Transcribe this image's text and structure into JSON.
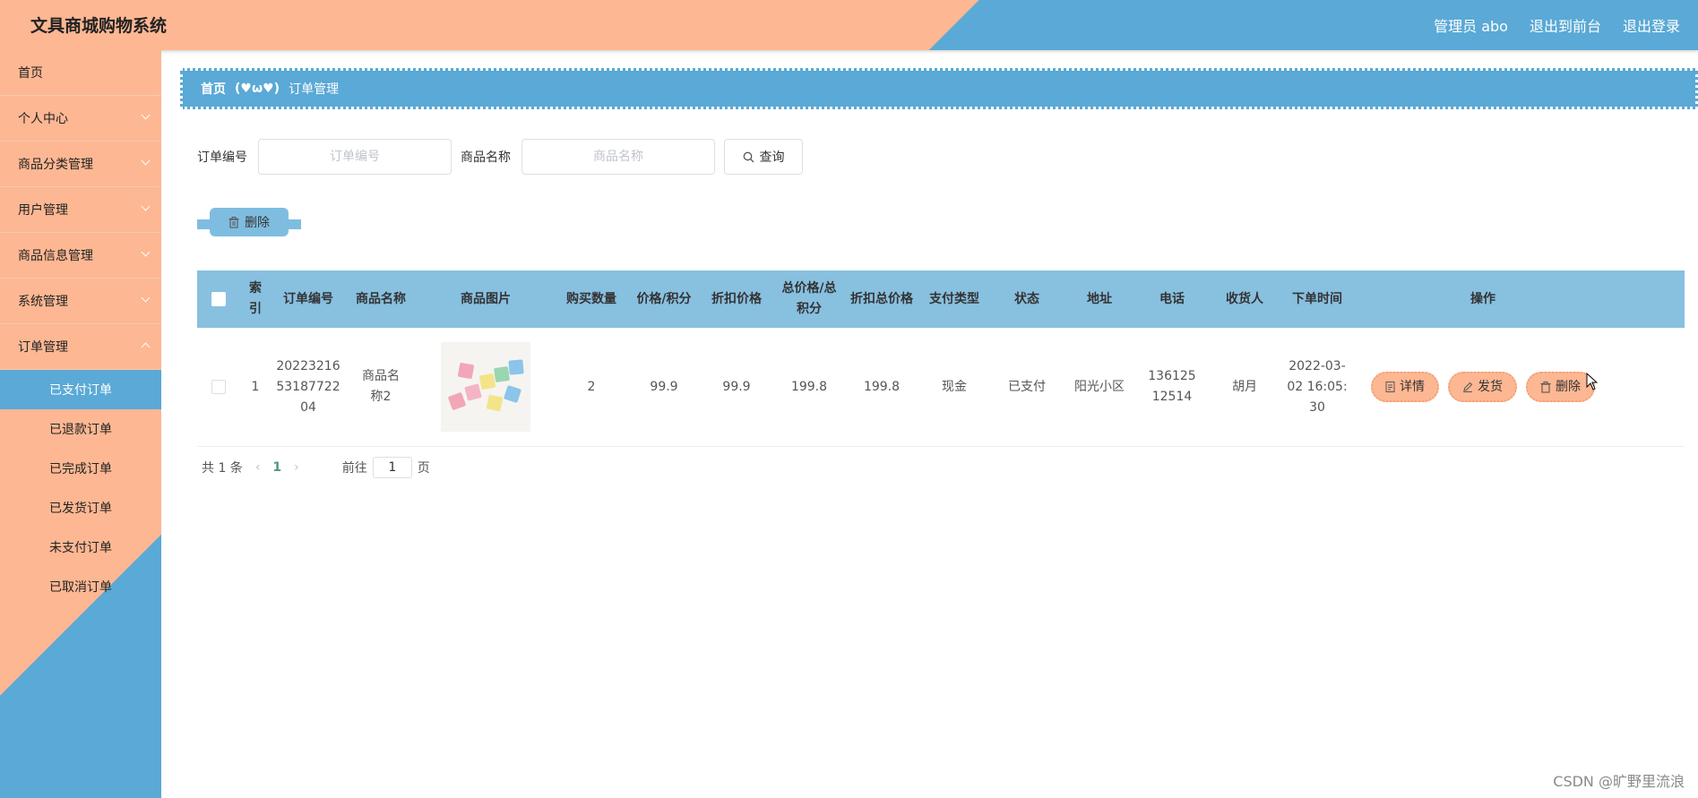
{
  "header": {
    "title": "文具商城购物系统",
    "admin_label": "管理员 abo",
    "back_label": "退出到前台",
    "logout_label": "退出登录"
  },
  "sidebar": {
    "items": [
      {
        "label": "首页"
      },
      {
        "label": "个人中心"
      },
      {
        "label": "商品分类管理"
      },
      {
        "label": "用户管理"
      },
      {
        "label": "商品信息管理"
      },
      {
        "label": "系统管理"
      },
      {
        "label": "订单管理"
      }
    ],
    "subitems": [
      {
        "label": "已支付订单"
      },
      {
        "label": "已退款订单"
      },
      {
        "label": "已完成订单"
      },
      {
        "label": "已发货订单"
      },
      {
        "label": "未支付订单"
      },
      {
        "label": "已取消订单"
      }
    ]
  },
  "breadcrumb": {
    "home": "首页",
    "separator": "(♥ω♥)",
    "current": "订单管理"
  },
  "search": {
    "order_label": "订单编号",
    "order_placeholder": "订单编号",
    "product_label": "商品名称",
    "product_placeholder": "商品名称",
    "query_label": "查询"
  },
  "toolbar": {
    "delete_label": "删除"
  },
  "table": {
    "headers": [
      "索引",
      "订单编号",
      "商品名称",
      "商品图片",
      "购买数量",
      "价格/积分",
      "折扣价格",
      "总价格/总积分",
      "折扣总价格",
      "支付类型",
      "状态",
      "地址",
      "电话",
      "收货人",
      "下单时间",
      "操作"
    ],
    "rows": [
      {
        "index": "1",
        "order_no": "2022321653187722 04",
        "product_name": "商品名称2",
        "quantity": "2",
        "price": "99.9",
        "discount_price": "99.9",
        "total": "199.8",
        "discount_total": "199.8",
        "pay_type": "现金",
        "status": "已支付",
        "address": "阳光小区",
        "phone": "13612512514",
        "receiver": "胡月",
        "order_time": "2022-03-02 16:05:30"
      }
    ],
    "actions": {
      "detail": "详情",
      "ship": "发货",
      "delete": "删除"
    }
  },
  "pagination": {
    "total_text": "共 1 条",
    "current_page": "1",
    "goto_label": "前往",
    "goto_value": "1",
    "page_suffix": "页"
  },
  "watermark": "CSDN @旷野里流浪",
  "colors": {
    "peach": "#fdb793",
    "blue": "#5aa9d6",
    "table_header": "#88c0e0"
  }
}
